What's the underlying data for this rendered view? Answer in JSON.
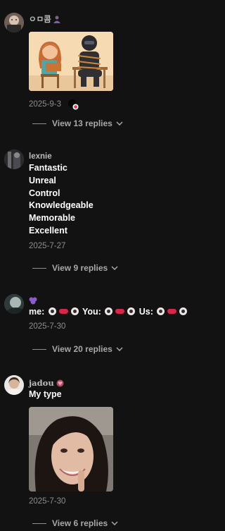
{
  "comments": [
    {
      "username": "ㅇㅁ콤",
      "date": "2025-9-3",
      "replies_label": "View 13 replies"
    },
    {
      "username": "lexnie",
      "lines": [
        "Fantastic",
        "Unreal",
        "Control",
        "Knowledgeable",
        "Memorable",
        "Excellent"
      ],
      "date": "2025-7-27",
      "replies_label": "View 9 replies"
    },
    {
      "username": "",
      "text_parts": [
        "me:",
        "You:",
        "Us:"
      ],
      "date": "2025-7-30",
      "replies_label": "View 20 replies"
    },
    {
      "username": "jadou",
      "text": "My type",
      "date": "2025-7-30",
      "replies_label": "View 6 replies"
    }
  ],
  "icons": {
    "chevron": "chevron-down-icon",
    "purple_accent": "#8a5cc7",
    "badge_red": "#e4324a"
  }
}
